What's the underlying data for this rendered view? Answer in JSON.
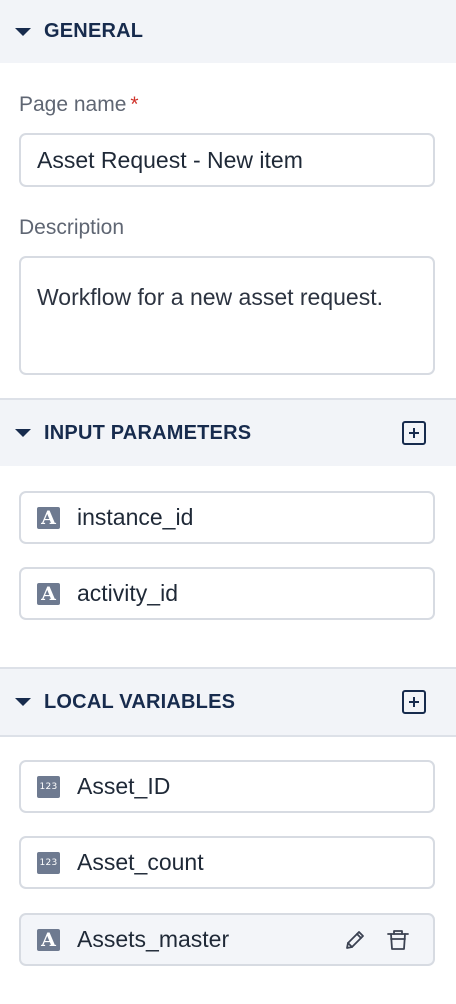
{
  "general": {
    "title": "GENERAL",
    "page_name_label": "Page name",
    "required_marker": "*",
    "page_name_value": "Asset Request - New item",
    "description_label": "Description",
    "description_value": "Workflow for a new asset request."
  },
  "input_parameters": {
    "title": "INPUT PARAMETERS",
    "items": [
      {
        "name": "instance_id",
        "type_icon": "string-type-icon",
        "type_glyph": "A"
      },
      {
        "name": "activity_id",
        "type_icon": "string-type-icon",
        "type_glyph": "A"
      }
    ]
  },
  "local_variables": {
    "title": "LOCAL VARIABLES",
    "items": [
      {
        "name": "Asset_ID",
        "type_icon": "number-type-icon",
        "type_glyph": "123"
      },
      {
        "name": "Asset_count",
        "type_icon": "number-type-icon",
        "type_glyph": "123"
      },
      {
        "name": "Assets_master",
        "type_icon": "string-type-icon",
        "type_glyph": "A",
        "actions": [
          "edit-icon",
          "delete-icon"
        ]
      }
    ]
  },
  "colors": {
    "header_text": "#172b4d",
    "header_bg": "#f2f4f8",
    "required": "#d0342c",
    "type_icon_bg": "#6e7a90"
  }
}
